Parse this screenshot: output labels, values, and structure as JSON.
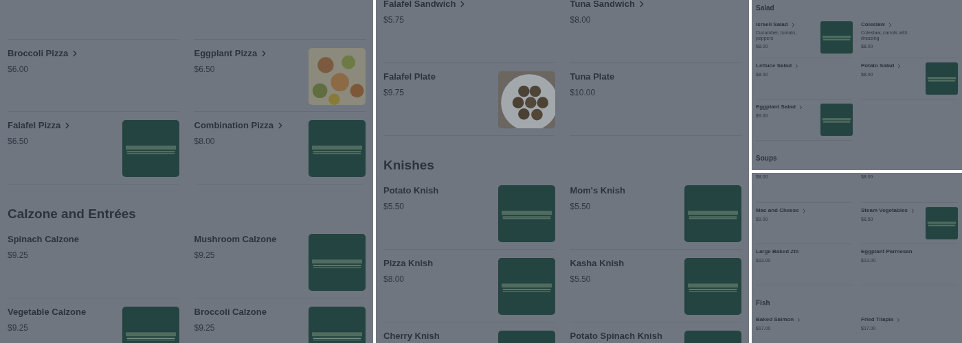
{
  "panels": [
    {
      "kind": "wide",
      "blocks": [
        {
          "kind": "row",
          "items": [
            {
              "kind": "plain",
              "name": "Broccoli Pizza",
              "chevron": true,
              "price": "$6.00"
            },
            {
              "kind": "pizza",
              "name": "Eggplant Pizza",
              "chevron": true,
              "price": "$6.50"
            }
          ]
        },
        {
          "kind": "row",
          "items": [
            {
              "kind": "logo",
              "name": "Falafel Pizza",
              "chevron": true,
              "price": "$6.50"
            },
            {
              "kind": "logo",
              "name": "Combination Pizza",
              "chevron": true,
              "price": "$8.00"
            }
          ]
        },
        {
          "kind": "heading",
          "text": "Calzone and Entrées"
        },
        {
          "kind": "row",
          "items": [
            {
              "kind": "plain",
              "name": "Spinach Calzone",
              "chevron": false,
              "price": "$9.25"
            },
            {
              "kind": "logo",
              "name": "Mushroom Calzone",
              "chevron": false,
              "price": "$9.25"
            }
          ]
        },
        {
          "kind": "row",
          "items": [
            {
              "kind": "logo",
              "name": "Vegetable Calzone",
              "chevron": false,
              "price": "$9.25"
            },
            {
              "kind": "logo",
              "name": "Broccoli Calzone",
              "chevron": false,
              "price": "$9.25"
            }
          ]
        }
      ]
    },
    {
      "kind": "wide",
      "blocks": [
        {
          "kind": "row",
          "items": [
            {
              "kind": "plain",
              "name": "Falafel Sandwich",
              "chevron": true,
              "price": "$5.75"
            },
            {
              "kind": "plain",
              "name": "Tuna Sandwich",
              "chevron": true,
              "price": "$8.00"
            }
          ]
        },
        {
          "kind": "row",
          "items": [
            {
              "kind": "falafel",
              "name": "Falafel Plate",
              "chevron": false,
              "price": "$9.75"
            },
            {
              "kind": "plain",
              "name": "Tuna Plate",
              "chevron": false,
              "price": "$10.00"
            }
          ]
        },
        {
          "kind": "heading",
          "text": "Knishes"
        },
        {
          "kind": "row",
          "items": [
            {
              "kind": "logo",
              "name": "Potato Knish",
              "chevron": false,
              "price": "$5.50"
            },
            {
              "kind": "logo",
              "name": "Mom's Knish",
              "chevron": false,
              "price": "$5.50"
            }
          ]
        },
        {
          "kind": "row",
          "items": [
            {
              "kind": "logo",
              "name": "Pizza Knish",
              "chevron": false,
              "price": "$8.00"
            },
            {
              "kind": "logo",
              "name": "Kasha Knish",
              "chevron": false,
              "price": "$5.50"
            }
          ]
        },
        {
          "kind": "row",
          "items": [
            {
              "kind": "logo",
              "name": "Cherry Knish",
              "chevron": false
            },
            {
              "kind": "logo",
              "name": "Potato Spinach Knish",
              "chevron": false
            }
          ]
        }
      ]
    },
    {
      "kind": "narrow",
      "blocks": [
        {
          "kind": "heading",
          "text": "Salad"
        },
        {
          "kind": "row",
          "items": [
            {
              "kind": "logo",
              "name": "Israeli Salad",
              "chevron": true,
              "description": "Cucumber, tomato, peppers",
              "price": "$8.00"
            },
            {
              "kind": "plain",
              "name": "Coleslaw",
              "chevron": true,
              "description": "Coleslaw, carrots with dressing",
              "price": "$8.00"
            }
          ]
        },
        {
          "kind": "row",
          "items": [
            {
              "kind": "plain",
              "name": "Lettuce Salad",
              "chevron": true,
              "price": "$8.00"
            },
            {
              "kind": "logo",
              "name": "Potato Salad",
              "chevron": true,
              "price": "$8.00"
            }
          ]
        },
        {
          "kind": "row",
          "items": [
            {
              "kind": "logo",
              "name": "Eggplant Salad",
              "chevron": true,
              "price": "$9.00"
            }
          ]
        },
        {
          "kind": "heading",
          "text": "Soups"
        }
      ]
    },
    {
      "kind": "narrow",
      "blocks": [
        {
          "kind": "row",
          "items": [
            {
              "kind": "plain",
              "price": "$8.00"
            },
            {
              "kind": "plain",
              "price": "$8.00"
            }
          ]
        },
        {
          "kind": "row",
          "items": [
            {
              "kind": "plain",
              "name": "Mac and Cheese",
              "chevron": true,
              "price": "$9.00"
            },
            {
              "kind": "logo",
              "name": "Steam Vegetables",
              "chevron": true,
              "price": "$8.50"
            }
          ]
        },
        {
          "kind": "row",
          "items": [
            {
              "kind": "plain",
              "name": "Large Baked Ziti",
              "chevron": false,
              "price": "$13.00"
            },
            {
              "kind": "plain",
              "name": "Eggplant Parmesan",
              "chevron": false,
              "price": "$13.00"
            }
          ]
        },
        {
          "kind": "heading",
          "text": "Fish"
        },
        {
          "kind": "row",
          "items": [
            {
              "kind": "plain",
              "name": "Baked Salmon",
              "chevron": true,
              "price": "$17.00"
            },
            {
              "kind": "plain",
              "name": "Fried Tilapia",
              "chevron": true,
              "price": "$17.00"
            }
          ]
        }
      ]
    }
  ]
}
